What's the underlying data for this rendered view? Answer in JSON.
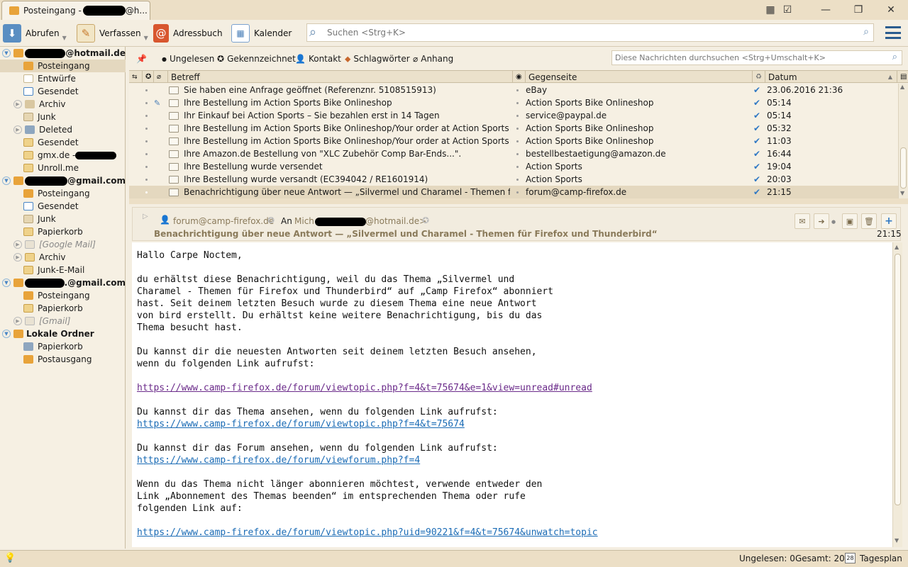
{
  "tab": {
    "title_start": "Posteingang - ",
    "title_end": "@h..."
  },
  "toolbar": {
    "fetch": "Abrufen",
    "compose": "Verfassen",
    "addressbook": "Adressbuch",
    "calendar": "Kalender",
    "search_placeholder": "Suchen <Strg+K>"
  },
  "accounts": {
    "a1_suffix": "@hotmail.de",
    "a1_folders": [
      "Posteingang",
      "Entwürfe",
      "Gesendet",
      "Archiv",
      "Junk",
      "Deleted",
      "Gesendet",
      "gmx.de - ",
      "Unroll.me"
    ],
    "a2_suffix": "@gmail.com",
    "a2_folders": [
      "Posteingang",
      "Gesendet",
      "Junk",
      "Papierkorb",
      "[Google Mail]",
      "Archiv",
      "Junk-E-Mail"
    ],
    "a3_suffix": ".@gmail.com",
    "a3_folders": [
      "Posteingang",
      "Papierkorb",
      "[Gmail]"
    ],
    "local": "Lokale Ordner",
    "local_folders": [
      "Papierkorb",
      "Postausgang"
    ]
  },
  "filters": {
    "unread": "Ungelesen",
    "starred": "Gekennzeichnet",
    "contact": "Kontakt",
    "tags": "Schlagwörter",
    "attachment": "Anhang",
    "search_placeholder": "Diese Nachrichten durchsuchen <Strg+Umschalt+K>"
  },
  "columns": {
    "subject": "Betreff",
    "correspondent": "Gegenseite",
    "date": "Datum"
  },
  "messages": [
    {
      "subject": "Sie haben eine Anfrage geöffnet (Referenznr. 5108515913)",
      "from": "eBay",
      "date": "23.06.2016 21:36"
    },
    {
      "subject": "Ihre Bestellung im Action Sports Bike Onlineshop",
      "from": "Action Sports Bike Onlineshop",
      "date": "05:14"
    },
    {
      "subject": "Ihr Einkauf bei Action Sports – Sie bezahlen erst in 14 Tagen",
      "from": "service@paypal.de",
      "date": "05:14"
    },
    {
      "subject": "Ihre Bestellung im Action Sports Bike Onlineshop/Your order at Action Sports Bike O...",
      "from": "Action Sports Bike Onlineshop",
      "date": "05:32"
    },
    {
      "subject": "Ihre Bestellung im Action Sports Bike Onlineshop/Your order at Action Sports Bike O...",
      "from": "Action Sports Bike Onlineshop",
      "date": "11:03"
    },
    {
      "subject": "Ihre Amazon.de Bestellung von \"XLC Zubehör Comp Bar-Ends...\".",
      "from": "bestellbestaetigung@amazon.de",
      "date": "16:44"
    },
    {
      "subject": "Ihre Bestellung wurde versendet",
      "from": "Action Sports",
      "date": "19:04"
    },
    {
      "subject": "Ihre Bestellung wurde versandt (EC394042 / RE1601914)",
      "from": "Action Sports",
      "date": "20:03"
    },
    {
      "subject": "Benachrichtigung über neue Antwort — „Silvermel und Charamel - Themen für Firef...",
      "from": "forum@camp-firefox.de",
      "date": "21:15"
    }
  ],
  "message": {
    "from": "forum@camp-firefox.de",
    "to_label": "An",
    "to_prefix": "Mich",
    "to_suffix": "@hotmail.de>",
    "subject": "Benachrichtigung über neue Antwort — „Silvermel und Charamel - Themen für Firefox und Thunderbird“",
    "time": "21:15",
    "greeting": "Hallo Carpe Noctem,",
    "para1": "du erhältst diese Benachrichtigung, weil du das Thema „Silvermel und\nCharamel - Themen für Firefox und Thunderbird“ auf „Camp Firefox“ abonniert\nhast. Seit deinem letzten Besuch wurde zu diesem Thema eine neue Antwort\nvon bird erstellt. Du erhältst keine weitere Benachrichtigung, bis du das\nThema besucht hast.",
    "para2": "Du kannst dir die neuesten Antworten seit deinem letzten Besuch ansehen,\nwenn du folgenden Link aufrufst:",
    "link1": "https://www.camp-firefox.de/forum/viewtopic.php?f=4&t=75674&e=1&view=unread#unread",
    "para3": "Du kannst dir das Thema ansehen, wenn du folgenden Link aufrufst:",
    "link2": "https://www.camp-firefox.de/forum/viewtopic.php?f=4&t=75674",
    "para4": "Du kannst dir das Forum ansehen, wenn du folgenden Link aufrufst:",
    "link3": "https://www.camp-firefox.de/forum/viewforum.php?f=4",
    "para5": "Wenn du das Thema nicht länger abonnieren möchtest, verwende entweder den\nLink „Abonnement des Themas beenden“ im entsprechenden Thema oder rufe\nfolgenden Link auf:",
    "link4": "https://www.camp-firefox.de/forum/viewtopic.php?uid=90221&f=4&t=75674&unwatch=topic"
  },
  "status": {
    "unread": "Ungelesen: 0",
    "total": "Gesamt: 20",
    "today": "Tagesplan",
    "cal_day": "28"
  },
  "colors": {
    "accent": "#2f78c4",
    "selected": "#e4d8bf",
    "background": "#f4eee1"
  }
}
